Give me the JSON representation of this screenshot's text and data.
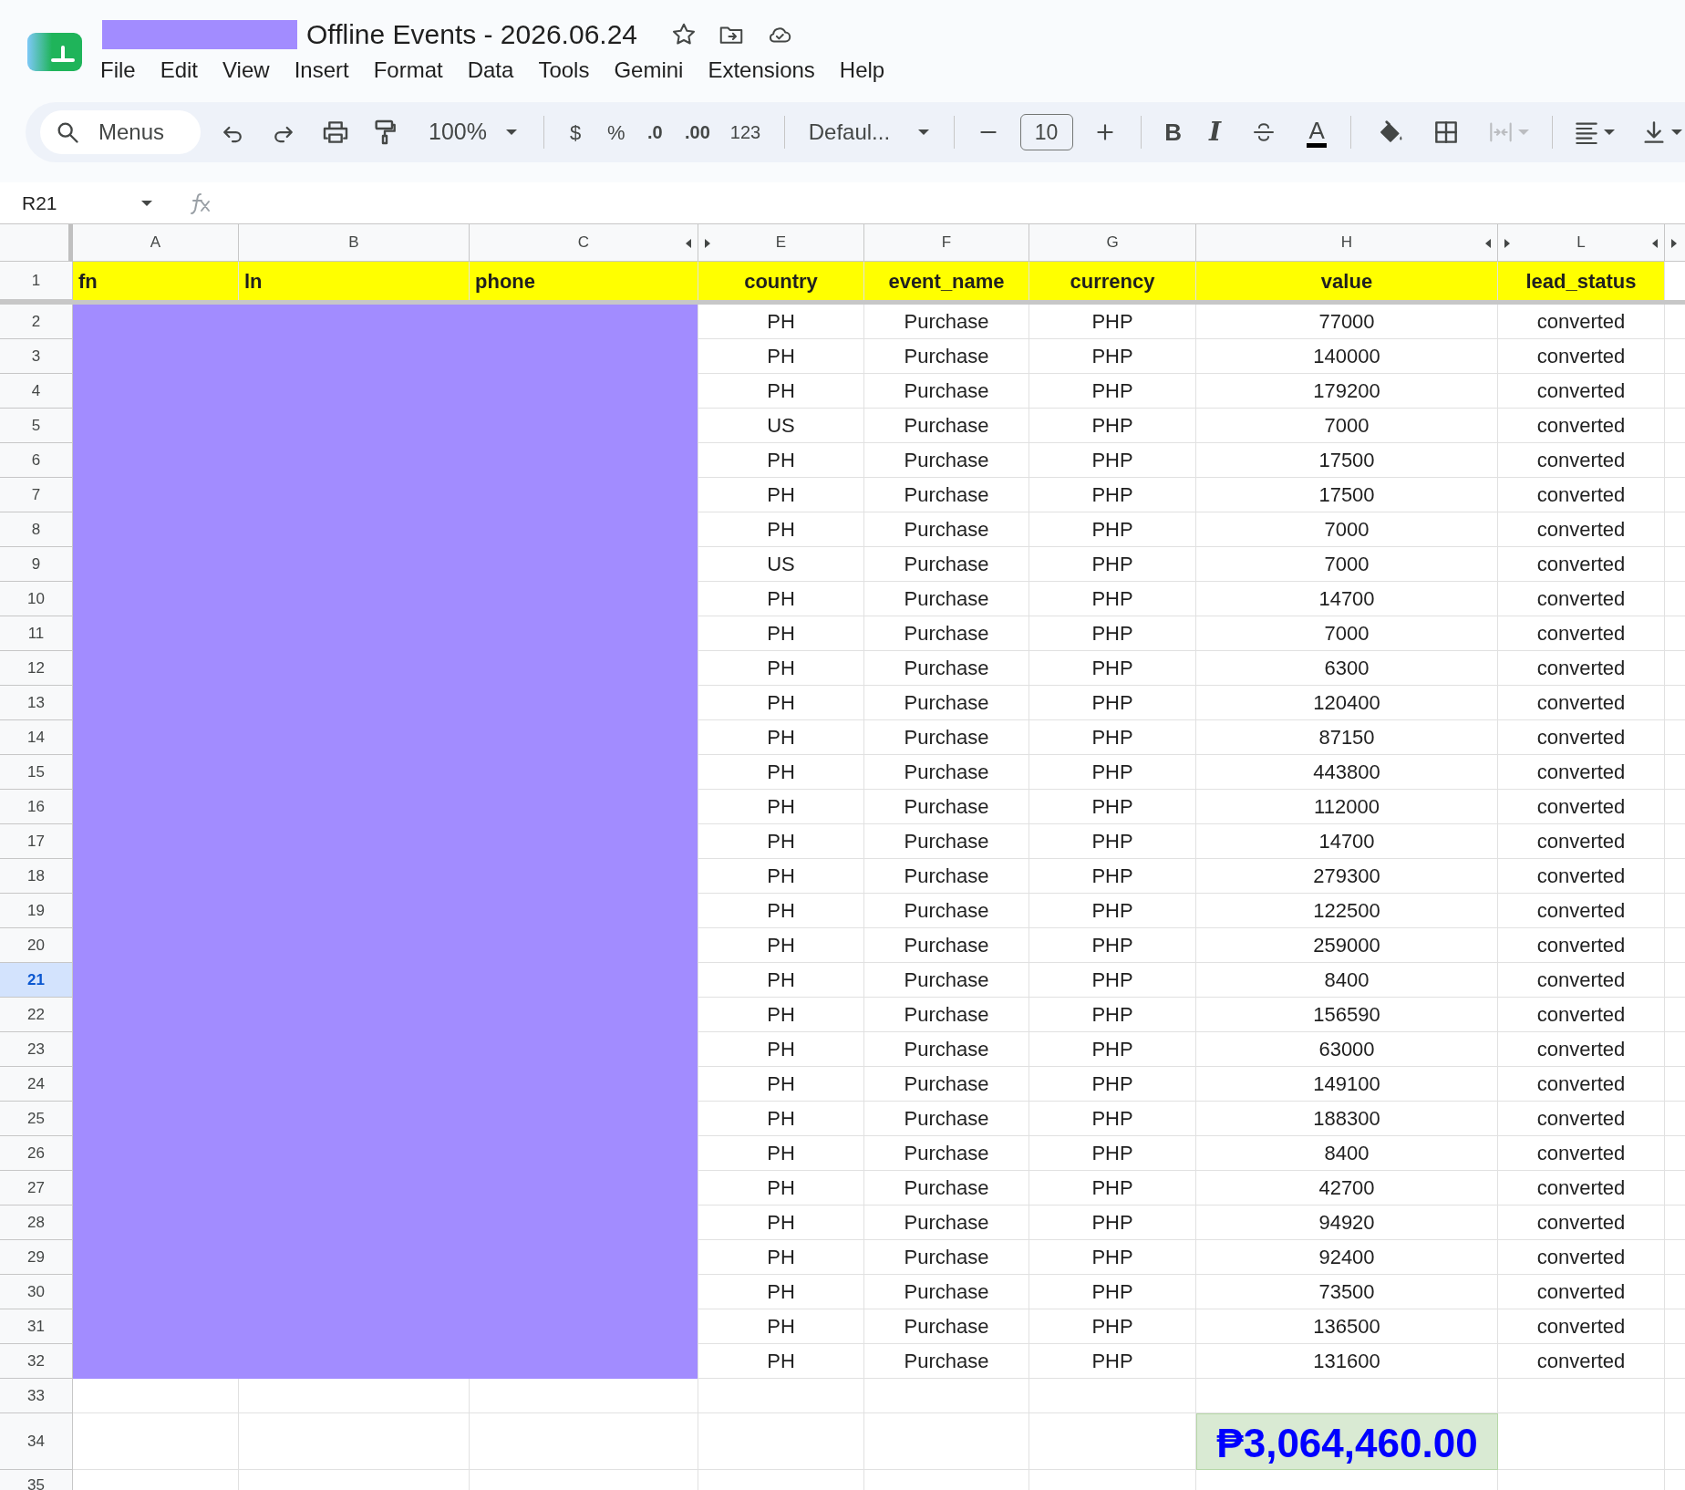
{
  "document": {
    "title": "Offline Events - 2026.06.24"
  },
  "menu": [
    "File",
    "Edit",
    "View",
    "Insert",
    "Format",
    "Data",
    "Tools",
    "Gemini",
    "Extensions",
    "Help"
  ],
  "toolbar": {
    "search_placeholder": "Menus",
    "zoom": "100%",
    "format_labels": [
      "$",
      "%",
      ".0",
      ".00",
      "123"
    ],
    "font": "Defaul...",
    "font_size": "10",
    "style_labels": [
      "B",
      "I"
    ],
    "text_color_label": "A"
  },
  "name_box": "R21",
  "columns": [
    {
      "letter": "A",
      "collapsed_after": false
    },
    {
      "letter": "B",
      "collapsed_after": false
    },
    {
      "letter": "C",
      "collapsed_after": true
    },
    {
      "letter": "E",
      "collapsed_after": false
    },
    {
      "letter": "F",
      "collapsed_after": false
    },
    {
      "letter": "G",
      "collapsed_after": false
    },
    {
      "letter": "H",
      "collapsed_after": true
    },
    {
      "letter": "L",
      "collapsed_after": true
    }
  ],
  "header_row": {
    "number": "1",
    "cells": [
      "fn",
      "ln",
      "phone",
      "country",
      "event_name",
      "currency",
      "value",
      "lead_status"
    ]
  },
  "rows": [
    {
      "number": "2",
      "selected": false,
      "redacted": true,
      "cells": [
        "PH",
        "Purchase",
        "PHP",
        "77000",
        "converted"
      ]
    },
    {
      "number": "3",
      "selected": false,
      "redacted": true,
      "cells": [
        "PH",
        "Purchase",
        "PHP",
        "140000",
        "converted"
      ]
    },
    {
      "number": "4",
      "selected": false,
      "redacted": true,
      "cells": [
        "PH",
        "Purchase",
        "PHP",
        "179200",
        "converted"
      ]
    },
    {
      "number": "5",
      "selected": false,
      "redacted": true,
      "cells": [
        "US",
        "Purchase",
        "PHP",
        "7000",
        "converted"
      ]
    },
    {
      "number": "6",
      "selected": false,
      "redacted": true,
      "cells": [
        "PH",
        "Purchase",
        "PHP",
        "17500",
        "converted"
      ]
    },
    {
      "number": "7",
      "selected": false,
      "redacted": true,
      "cells": [
        "PH",
        "Purchase",
        "PHP",
        "17500",
        "converted"
      ]
    },
    {
      "number": "8",
      "selected": false,
      "redacted": true,
      "cells": [
        "PH",
        "Purchase",
        "PHP",
        "7000",
        "converted"
      ]
    },
    {
      "number": "9",
      "selected": false,
      "redacted": true,
      "cells": [
        "US",
        "Purchase",
        "PHP",
        "7000",
        "converted"
      ]
    },
    {
      "number": "10",
      "selected": false,
      "redacted": true,
      "cells": [
        "PH",
        "Purchase",
        "PHP",
        "14700",
        "converted"
      ]
    },
    {
      "number": "11",
      "selected": false,
      "redacted": true,
      "cells": [
        "PH",
        "Purchase",
        "PHP",
        "7000",
        "converted"
      ]
    },
    {
      "number": "12",
      "selected": false,
      "redacted": true,
      "cells": [
        "PH",
        "Purchase",
        "PHP",
        "6300",
        "converted"
      ]
    },
    {
      "number": "13",
      "selected": false,
      "redacted": true,
      "cells": [
        "PH",
        "Purchase",
        "PHP",
        "120400",
        "converted"
      ]
    },
    {
      "number": "14",
      "selected": false,
      "redacted": true,
      "cells": [
        "PH",
        "Purchase",
        "PHP",
        "87150",
        "converted"
      ]
    },
    {
      "number": "15",
      "selected": false,
      "redacted": true,
      "cells": [
        "PH",
        "Purchase",
        "PHP",
        "443800",
        "converted"
      ]
    },
    {
      "number": "16",
      "selected": false,
      "redacted": true,
      "cells": [
        "PH",
        "Purchase",
        "PHP",
        "112000",
        "converted"
      ]
    },
    {
      "number": "17",
      "selected": false,
      "redacted": true,
      "cells": [
        "PH",
        "Purchase",
        "PHP",
        "14700",
        "converted"
      ]
    },
    {
      "number": "18",
      "selected": false,
      "redacted": true,
      "cells": [
        "PH",
        "Purchase",
        "PHP",
        "279300",
        "converted"
      ]
    },
    {
      "number": "19",
      "selected": false,
      "redacted": true,
      "cells": [
        "PH",
        "Purchase",
        "PHP",
        "122500",
        "converted"
      ]
    },
    {
      "number": "20",
      "selected": false,
      "redacted": true,
      "cells": [
        "PH",
        "Purchase",
        "PHP",
        "259000",
        "converted"
      ]
    },
    {
      "number": "21",
      "selected": true,
      "redacted": true,
      "cells": [
        "PH",
        "Purchase",
        "PHP",
        "8400",
        "converted"
      ]
    },
    {
      "number": "22",
      "selected": false,
      "redacted": true,
      "cells": [
        "PH",
        "Purchase",
        "PHP",
        "156590",
        "converted"
      ]
    },
    {
      "number": "23",
      "selected": false,
      "redacted": true,
      "cells": [
        "PH",
        "Purchase",
        "PHP",
        "63000",
        "converted"
      ]
    },
    {
      "number": "24",
      "selected": false,
      "redacted": true,
      "cells": [
        "PH",
        "Purchase",
        "PHP",
        "149100",
        "converted"
      ]
    },
    {
      "number": "25",
      "selected": false,
      "redacted": true,
      "cells": [
        "PH",
        "Purchase",
        "PHP",
        "188300",
        "converted"
      ]
    },
    {
      "number": "26",
      "selected": false,
      "redacted": true,
      "cells": [
        "PH",
        "Purchase",
        "PHP",
        "8400",
        "converted"
      ]
    },
    {
      "number": "27",
      "selected": false,
      "redacted": true,
      "cells": [
        "PH",
        "Purchase",
        "PHP",
        "42700",
        "converted"
      ]
    },
    {
      "number": "28",
      "selected": false,
      "redacted": true,
      "cells": [
        "PH",
        "Purchase",
        "PHP",
        "94920",
        "converted"
      ]
    },
    {
      "number": "29",
      "selected": false,
      "redacted": true,
      "cells": [
        "PH",
        "Purchase",
        "PHP",
        "92400",
        "converted"
      ]
    },
    {
      "number": "30",
      "selected": false,
      "redacted": true,
      "cells": [
        "PH",
        "Purchase",
        "PHP",
        "73500",
        "converted"
      ]
    },
    {
      "number": "31",
      "selected": false,
      "redacted": true,
      "cells": [
        "PH",
        "Purchase",
        "PHP",
        "136500",
        "converted"
      ]
    },
    {
      "number": "32",
      "selected": false,
      "redacted": true,
      "cells": [
        "PH",
        "Purchase",
        "PHP",
        "131600",
        "converted"
      ]
    },
    {
      "number": "33",
      "selected": false,
      "redacted": false
    }
  ],
  "total_row": {
    "number": "34",
    "value": "₱3,064,460.00"
  },
  "last_row": {
    "number": "35"
  }
}
